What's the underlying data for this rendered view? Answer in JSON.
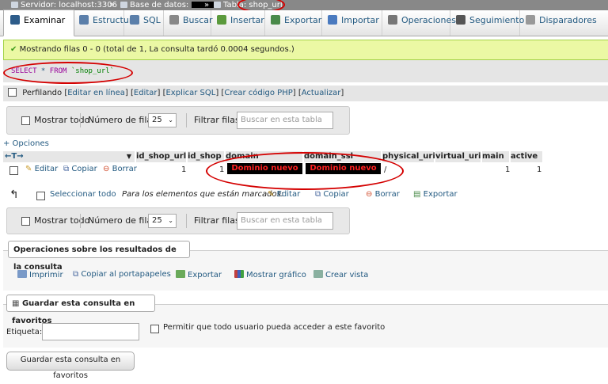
{
  "breadcrumb": {
    "server": "Servidor: localhost:3306",
    "database": "Base de datos:",
    "table_prefix": "Tabla:",
    "table": "shop_url"
  },
  "tabs": [
    {
      "label": "Examinar",
      "icon": "browse-icon",
      "color": "#2d5c8a"
    },
    {
      "label": "Estructura",
      "icon": "structure-icon",
      "color": "#5b7faa"
    },
    {
      "label": "SQL",
      "icon": "sql-icon",
      "color": "#5b7faa"
    },
    {
      "label": "Buscar",
      "icon": "search-icon",
      "color": "#888888"
    },
    {
      "label": "Insertar",
      "icon": "insert-icon",
      "color": "#5b9a3c"
    },
    {
      "label": "Exportar",
      "icon": "export-icon",
      "color": "#4a8a4a"
    },
    {
      "label": "Importar",
      "icon": "import-icon",
      "color": "#4a7abf"
    },
    {
      "label": "Operaciones",
      "icon": "wrench-icon",
      "color": "#777777"
    },
    {
      "label": "Seguimiento",
      "icon": "eye-icon",
      "color": "#555555"
    },
    {
      "label": "Disparadores",
      "icon": "trigger-icon",
      "color": "#999999"
    }
  ],
  "success_message": "Mostrando filas 0 - 0 (total de 1, La consulta tardó 0.0004 segundos.)",
  "sql": {
    "kw1": "SELECT",
    "star": " * ",
    "kw2": "FROM",
    "table": " `shop_url`"
  },
  "profiling": {
    "label": "Perfilando",
    "links": [
      "Editar en línea",
      "Editar",
      "Explicar SQL",
      "Crear código PHP",
      "Actualizar"
    ]
  },
  "nav": {
    "show_all": "Mostrar todo",
    "rows_label": "Número de filas:",
    "rows_value": "25",
    "filter_label": "Filtrar filas:",
    "filter_placeholder": "Buscar en esta tabla"
  },
  "options_link": "+ Opciones",
  "table": {
    "sort_arrows": "←T→",
    "columns": [
      "id_shop_url",
      "id_shop",
      "domain",
      "domain_ssl",
      "physical_uri",
      "virtual_uri",
      "main",
      "active"
    ],
    "row": {
      "edit": "Editar",
      "copy": "Copiar",
      "delete": "Borrar",
      "id_shop_url": "1",
      "id_shop": "1",
      "domain": "Dominio nuevo",
      "domain_ssl": "Dominio nuevo",
      "physical_uri": "/",
      "virtual_uri": "",
      "main": "1",
      "active": "1"
    }
  },
  "bulk": {
    "select_all": "Seleccionar todo",
    "with_selected": "Para los elementos que están marcados:",
    "edit": "Editar",
    "copy": "Copiar",
    "delete": "Borrar",
    "export": "Exportar"
  },
  "query_ops": {
    "legend": "Operaciones sobre los resultados de la consulta",
    "print": "Imprimir",
    "copy_clipboard": "Copiar al portapapeles",
    "export": "Exportar",
    "chart": "Mostrar gráfico",
    "create_view": "Crear vista"
  },
  "bookmark": {
    "legend": "Guardar esta consulta en favoritos",
    "label_field": "Etiqueta:",
    "public_checkbox": "Permitir que todo usuario pueda acceder a este favorito",
    "button": "Guardar esta consulta en favoritos"
  },
  "colors": {
    "link": "#235a81",
    "success_bg": "#ebf8a4",
    "annotation": "#d40000",
    "highlight_text": "#ff2020"
  }
}
